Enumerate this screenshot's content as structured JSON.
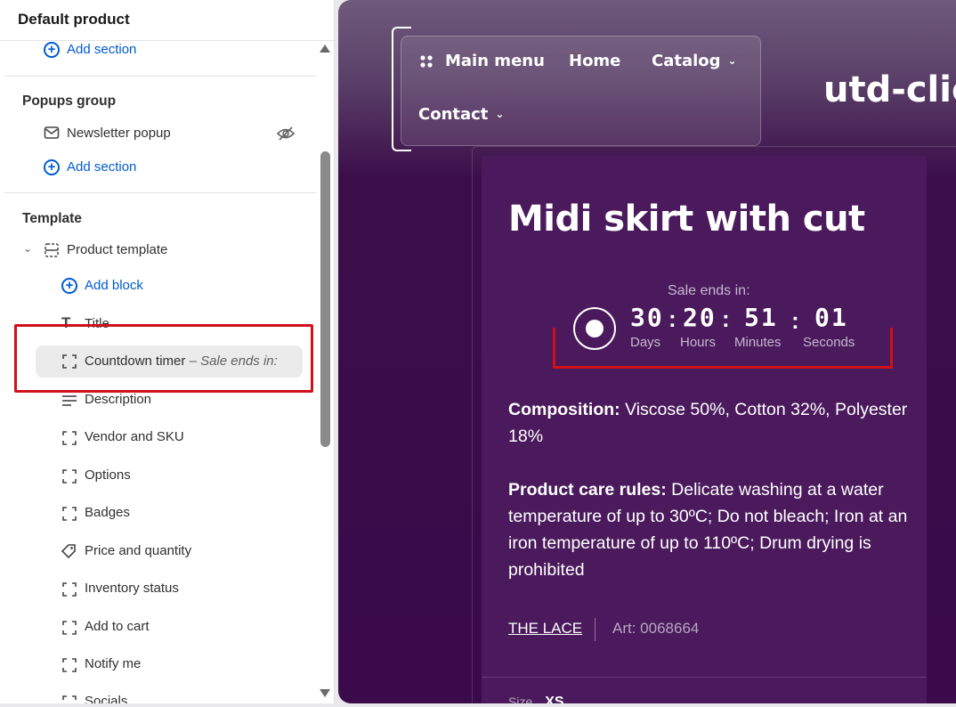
{
  "sidebar": {
    "header_title": "Default product",
    "add_section_1": "Add section",
    "popups_group": {
      "title": "Popups group",
      "newsletter": "Newsletter popup",
      "add_section": "Add section"
    },
    "template": {
      "title": "Template",
      "product_template": "Product template",
      "add_block": "Add block",
      "blocks": [
        "Title",
        "Countdown timer",
        "Description",
        "Vendor and SKU",
        "Options",
        "Badges",
        "Price and quantity",
        "Inventory status",
        "Add to cart",
        "Notify me",
        "Socials"
      ],
      "countdown_subtitle": "– Sale ends in:"
    }
  },
  "preview": {
    "menu": {
      "main_menu": "Main menu",
      "home": "Home",
      "catalog": "Catalog",
      "contact": "Contact"
    },
    "brand": "utd-clie",
    "product_title": "Midi skirt with cut",
    "countdown": {
      "label": "Sale ends in:",
      "days": "30",
      "hours": "20",
      "minutes": "51",
      "seconds": "01",
      "days_label": "Days",
      "hours_label": "Hours",
      "minutes_label": "Minutes",
      "seconds_label": "Seconds"
    },
    "composition_label": "Composition:",
    "composition_text": " Viscose 50%, Cotton 32%, Polyester 18%",
    "care_label": "Product care rules:",
    "care_text": " Delicate washing at a water temperature of up to 30ºC; Do not bleach; Iron at an iron temperature of up to 110ºC; Drum drying is prohibited",
    "vendor": "THE LACE",
    "art": "Art: 0068664",
    "size_label": "Size",
    "size_value": "XS"
  },
  "colors": {
    "link_blue": "#005bd3",
    "highlight_red": "#d0101a",
    "preview_bg": "#3a0a4a"
  }
}
